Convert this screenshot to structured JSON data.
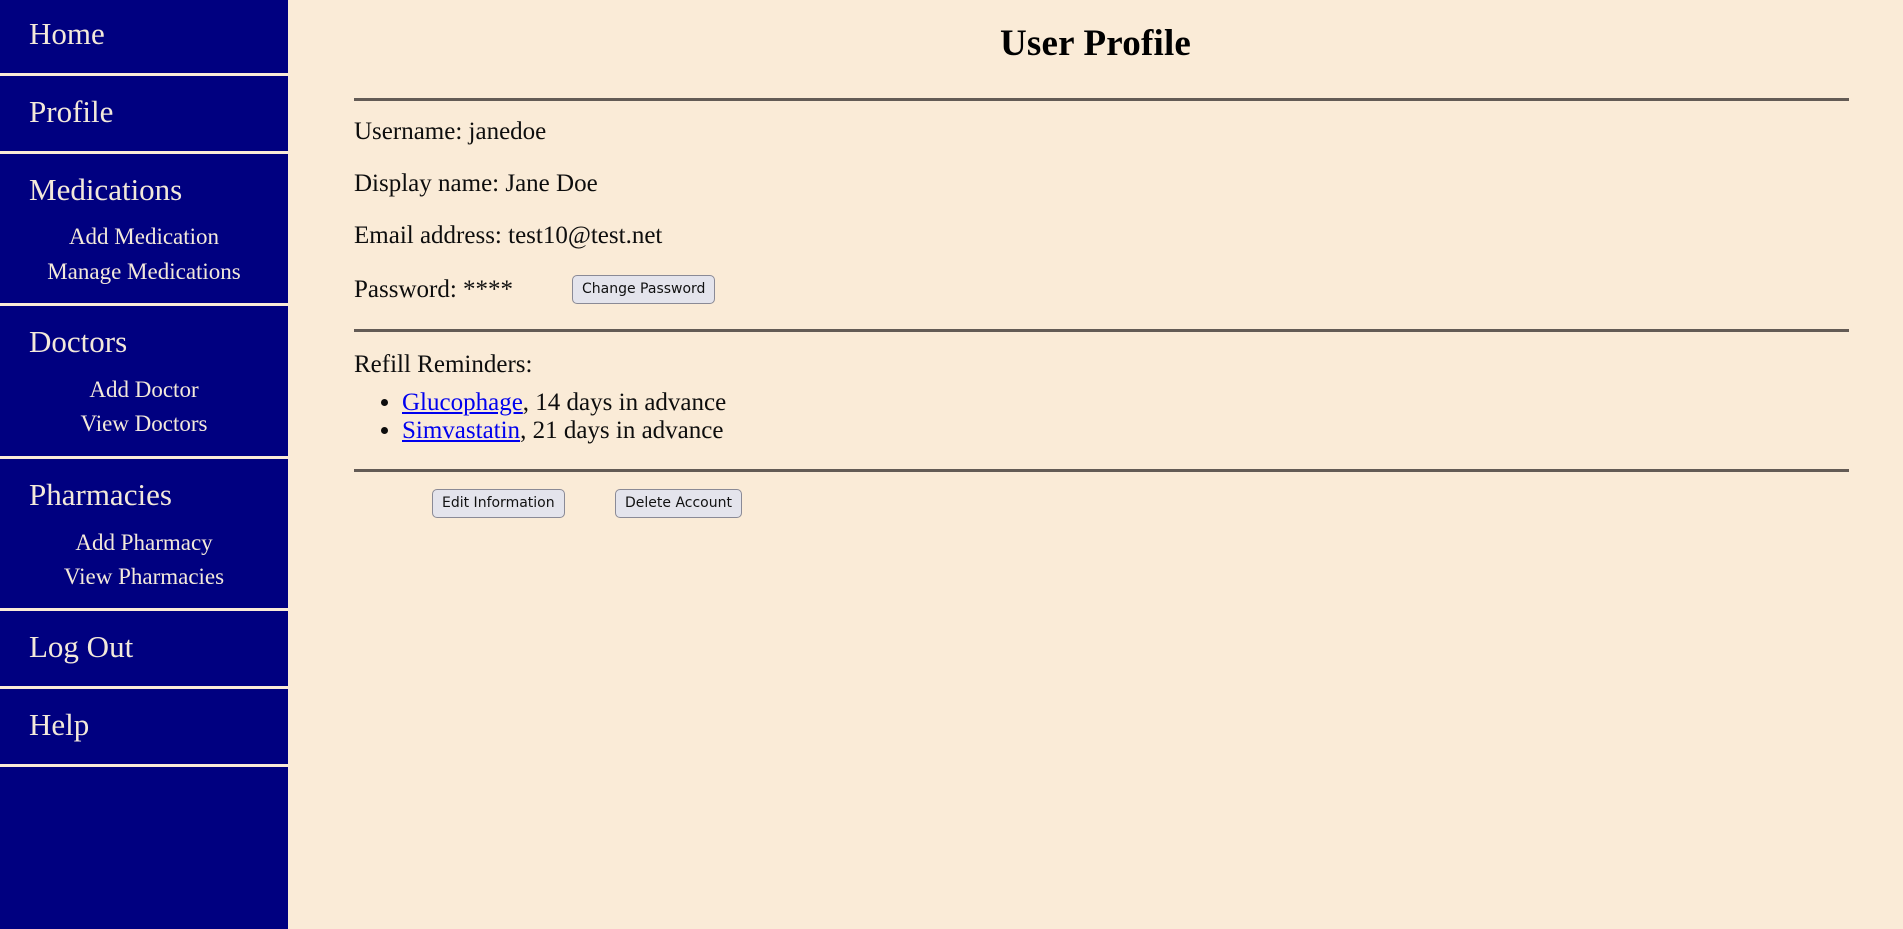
{
  "colors": {
    "sidebar_bg": "#000080",
    "page_bg": "#faebd7",
    "sidebar_text": "#f3e9da",
    "link": "#0000ee",
    "rule": "#635b55",
    "button_bg": "#e4e4ec"
  },
  "sidebar": {
    "groups": [
      {
        "label": "Home",
        "items": []
      },
      {
        "label": "Profile",
        "items": []
      },
      {
        "label": "Medications",
        "items": [
          "Add Medication",
          "Manage Medications"
        ]
      },
      {
        "label": "Doctors",
        "items": [
          "Add Doctor",
          "View Doctors"
        ]
      },
      {
        "label": "Pharmacies",
        "items": [
          "Add Pharmacy",
          "View Pharmacies"
        ]
      },
      {
        "label": "Log Out",
        "items": []
      },
      {
        "label": "Help",
        "items": []
      }
    ]
  },
  "main": {
    "title": "User Profile",
    "fields": {
      "username": "Username: janedoe",
      "display_name": "Display name: Jane Doe",
      "email": "Email address: test10@test.net",
      "password_label": "Password: ****",
      "change_password_button": "Change Password"
    },
    "reminders": {
      "heading": "Refill Reminders:",
      "items": [
        {
          "medication": "Glucophage",
          "detail": ", 14 days in advance"
        },
        {
          "medication": "Simvastatin",
          "detail": ", 21 days in advance"
        }
      ]
    },
    "actions": {
      "edit": "Edit Information",
      "delete": "Delete Account"
    }
  }
}
